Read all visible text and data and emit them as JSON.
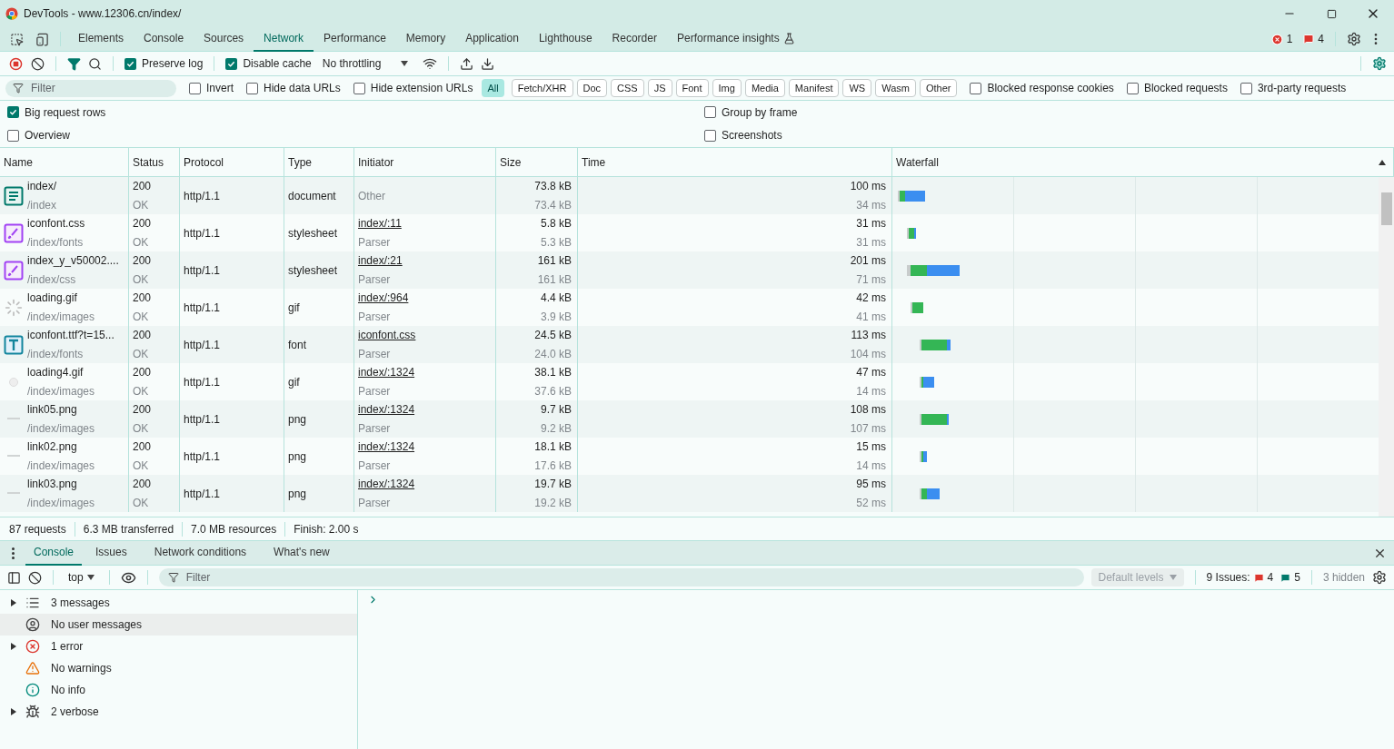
{
  "window": {
    "title": "DevTools - www.12306.cn/index/"
  },
  "panel_tabs": [
    {
      "label": "Elements",
      "selected": false
    },
    {
      "label": "Console",
      "selected": false
    },
    {
      "label": "Sources",
      "selected": false
    },
    {
      "label": "Network",
      "selected": true
    },
    {
      "label": "Performance",
      "selected": false
    },
    {
      "label": "Memory",
      "selected": false
    },
    {
      "label": "Application",
      "selected": false
    },
    {
      "label": "Lighthouse",
      "selected": false
    },
    {
      "label": "Recorder",
      "selected": false
    },
    {
      "label": "Performance insights",
      "selected": false
    }
  ],
  "counts": {
    "errors": "1",
    "issues": "4"
  },
  "toolbar": {
    "recording": true,
    "preserve_log": {
      "label": "Preserve log",
      "checked": true
    },
    "disable_cache": {
      "label": "Disable cache",
      "checked": true
    },
    "throttling": "No throttling"
  },
  "filter": {
    "placeholder": "Filter",
    "options_before": [
      {
        "label": "Invert",
        "checked": false
      },
      {
        "label": "Hide data URLs",
        "checked": false
      },
      {
        "label": "Hide extension URLs",
        "checked": false
      }
    ],
    "types": [
      {
        "label": "All",
        "selected": true
      },
      {
        "label": "Fetch/XHR",
        "selected": false
      },
      {
        "label": "Doc",
        "selected": false
      },
      {
        "label": "CSS",
        "selected": false
      },
      {
        "label": "JS",
        "selected": false
      },
      {
        "label": "Font",
        "selected": false
      },
      {
        "label": "Img",
        "selected": false
      },
      {
        "label": "Media",
        "selected": false
      },
      {
        "label": "Manifest",
        "selected": false
      },
      {
        "label": "WS",
        "selected": false
      },
      {
        "label": "Wasm",
        "selected": false
      },
      {
        "label": "Other",
        "selected": false
      }
    ],
    "options_after": [
      {
        "label": "Blocked response cookies",
        "checked": false
      },
      {
        "label": "Blocked requests",
        "checked": false
      },
      {
        "label": "3rd-party requests",
        "checked": false
      }
    ]
  },
  "settings": [
    {
      "label": "Big request rows",
      "checked": true
    },
    {
      "label": "Group by frame",
      "checked": false
    },
    {
      "label": "Overview",
      "checked": false
    },
    {
      "label": "Screenshots",
      "checked": false
    }
  ],
  "table": {
    "columns": [
      "Name",
      "Status",
      "Protocol",
      "Type",
      "Initiator",
      "Size",
      "Time",
      "Waterfall"
    ],
    "rows": [
      {
        "kind": "document",
        "name": "index/",
        "path": "/index",
        "status": "200",
        "status_text": "OK",
        "protocol": "http/1.1",
        "type": "document",
        "initiator": {
          "text": "Other",
          "link": false
        },
        "size": "73.8 kB",
        "resource_size": "73.4 kB",
        "time": "100 ms",
        "latency": "34 ms"
      },
      {
        "kind": "stylesheet",
        "name": "iconfont.css",
        "path": "/index/fonts",
        "status": "200",
        "status_text": "OK",
        "protocol": "http/1.1",
        "type": "stylesheet",
        "initiator": {
          "text": "index/:11",
          "link": true,
          "detail": "Parser"
        },
        "size": "5.8 kB",
        "resource_size": "5.3 kB",
        "time": "31 ms",
        "latency": "31 ms"
      },
      {
        "kind": "stylesheet",
        "name": "index_y_v50002....",
        "path": "/index/css",
        "status": "200",
        "status_text": "OK",
        "protocol": "http/1.1",
        "type": "stylesheet",
        "initiator": {
          "text": "index/:21",
          "link": true,
          "detail": "Parser"
        },
        "size": "161 kB",
        "resource_size": "161 kB",
        "time": "201 ms",
        "latency": "71 ms"
      },
      {
        "kind": "spinner",
        "name": "loading.gif",
        "path": "/index/images",
        "status": "200",
        "status_text": "OK",
        "protocol": "http/1.1",
        "type": "gif",
        "initiator": {
          "text": "index/:964",
          "link": true,
          "detail": "Parser"
        },
        "size": "4.4 kB",
        "resource_size": "3.9 kB",
        "time": "42 ms",
        "latency": "41 ms"
      },
      {
        "kind": "font",
        "name": "iconfont.ttf?t=15...",
        "path": "/index/fonts",
        "status": "200",
        "status_text": "OK",
        "protocol": "http/1.1",
        "type": "font",
        "initiator": {
          "text": "iconfont.css",
          "link": true,
          "detail": "Parser"
        },
        "size": "24.5 kB",
        "resource_size": "24.0 kB",
        "time": "113 ms",
        "latency": "104 ms"
      },
      {
        "kind": "dot",
        "name": "loading4.gif",
        "path": "/index/images",
        "status": "200",
        "status_text": "OK",
        "protocol": "http/1.1",
        "type": "gif",
        "initiator": {
          "text": "index/:1324",
          "link": true,
          "detail": "Parser"
        },
        "size": "38.1 kB",
        "resource_size": "37.6 kB",
        "time": "47 ms",
        "latency": "14 ms"
      },
      {
        "kind": "image",
        "name": "link05.png",
        "path": "/index/images",
        "status": "200",
        "status_text": "OK",
        "protocol": "http/1.1",
        "type": "png",
        "initiator": {
          "text": "index/:1324",
          "link": true,
          "detail": "Parser"
        },
        "size": "9.7 kB",
        "resource_size": "9.2 kB",
        "time": "108 ms",
        "latency": "107 ms"
      },
      {
        "kind": "image",
        "name": "link02.png",
        "path": "/index/images",
        "status": "200",
        "status_text": "OK",
        "protocol": "http/1.1",
        "type": "png",
        "initiator": {
          "text": "index/:1324",
          "link": true,
          "detail": "Parser"
        },
        "size": "18.1 kB",
        "resource_size": "17.6 kB",
        "time": "15 ms",
        "latency": "14 ms"
      },
      {
        "kind": "image",
        "name": "link03.png",
        "path": "/index/images",
        "status": "200",
        "status_text": "OK",
        "protocol": "http/1.1",
        "type": "png",
        "initiator": {
          "text": "index/:1324",
          "link": true,
          "detail": "Parser"
        },
        "size": "19.7 kB",
        "resource_size": "19.2 kB",
        "time": "95 ms",
        "latency": "52 ms"
      }
    ]
  },
  "summary": [
    "87 requests",
    "6.3 MB transferred",
    "7.0 MB resources",
    "Finish: 2.00 s"
  ],
  "drawer": {
    "tabs": [
      {
        "label": "Console",
        "selected": true
      },
      {
        "label": "Issues",
        "selected": false
      },
      {
        "label": "Network conditions",
        "selected": false
      },
      {
        "label": "What's new",
        "selected": false
      }
    ],
    "context": "top",
    "filter_placeholder": "Filter",
    "levels": "Default levels",
    "issues_label": "9 Issues:",
    "issue_errors": "4",
    "issue_info": "5",
    "hidden": "3 hidden",
    "sidebar": [
      {
        "kind": "messages",
        "label": "3 messages",
        "expandable": true,
        "selected": false
      },
      {
        "kind": "user",
        "label": "No user messages",
        "expandable": false,
        "selected": true
      },
      {
        "kind": "error",
        "label": "1 error",
        "expandable": true,
        "selected": false
      },
      {
        "kind": "warning",
        "label": "No warnings",
        "expandable": false,
        "selected": false
      },
      {
        "kind": "info",
        "label": "No info",
        "expandable": false,
        "selected": false
      },
      {
        "kind": "verbose",
        "label": "2 verbose",
        "expandable": true,
        "selected": false
      }
    ]
  }
}
